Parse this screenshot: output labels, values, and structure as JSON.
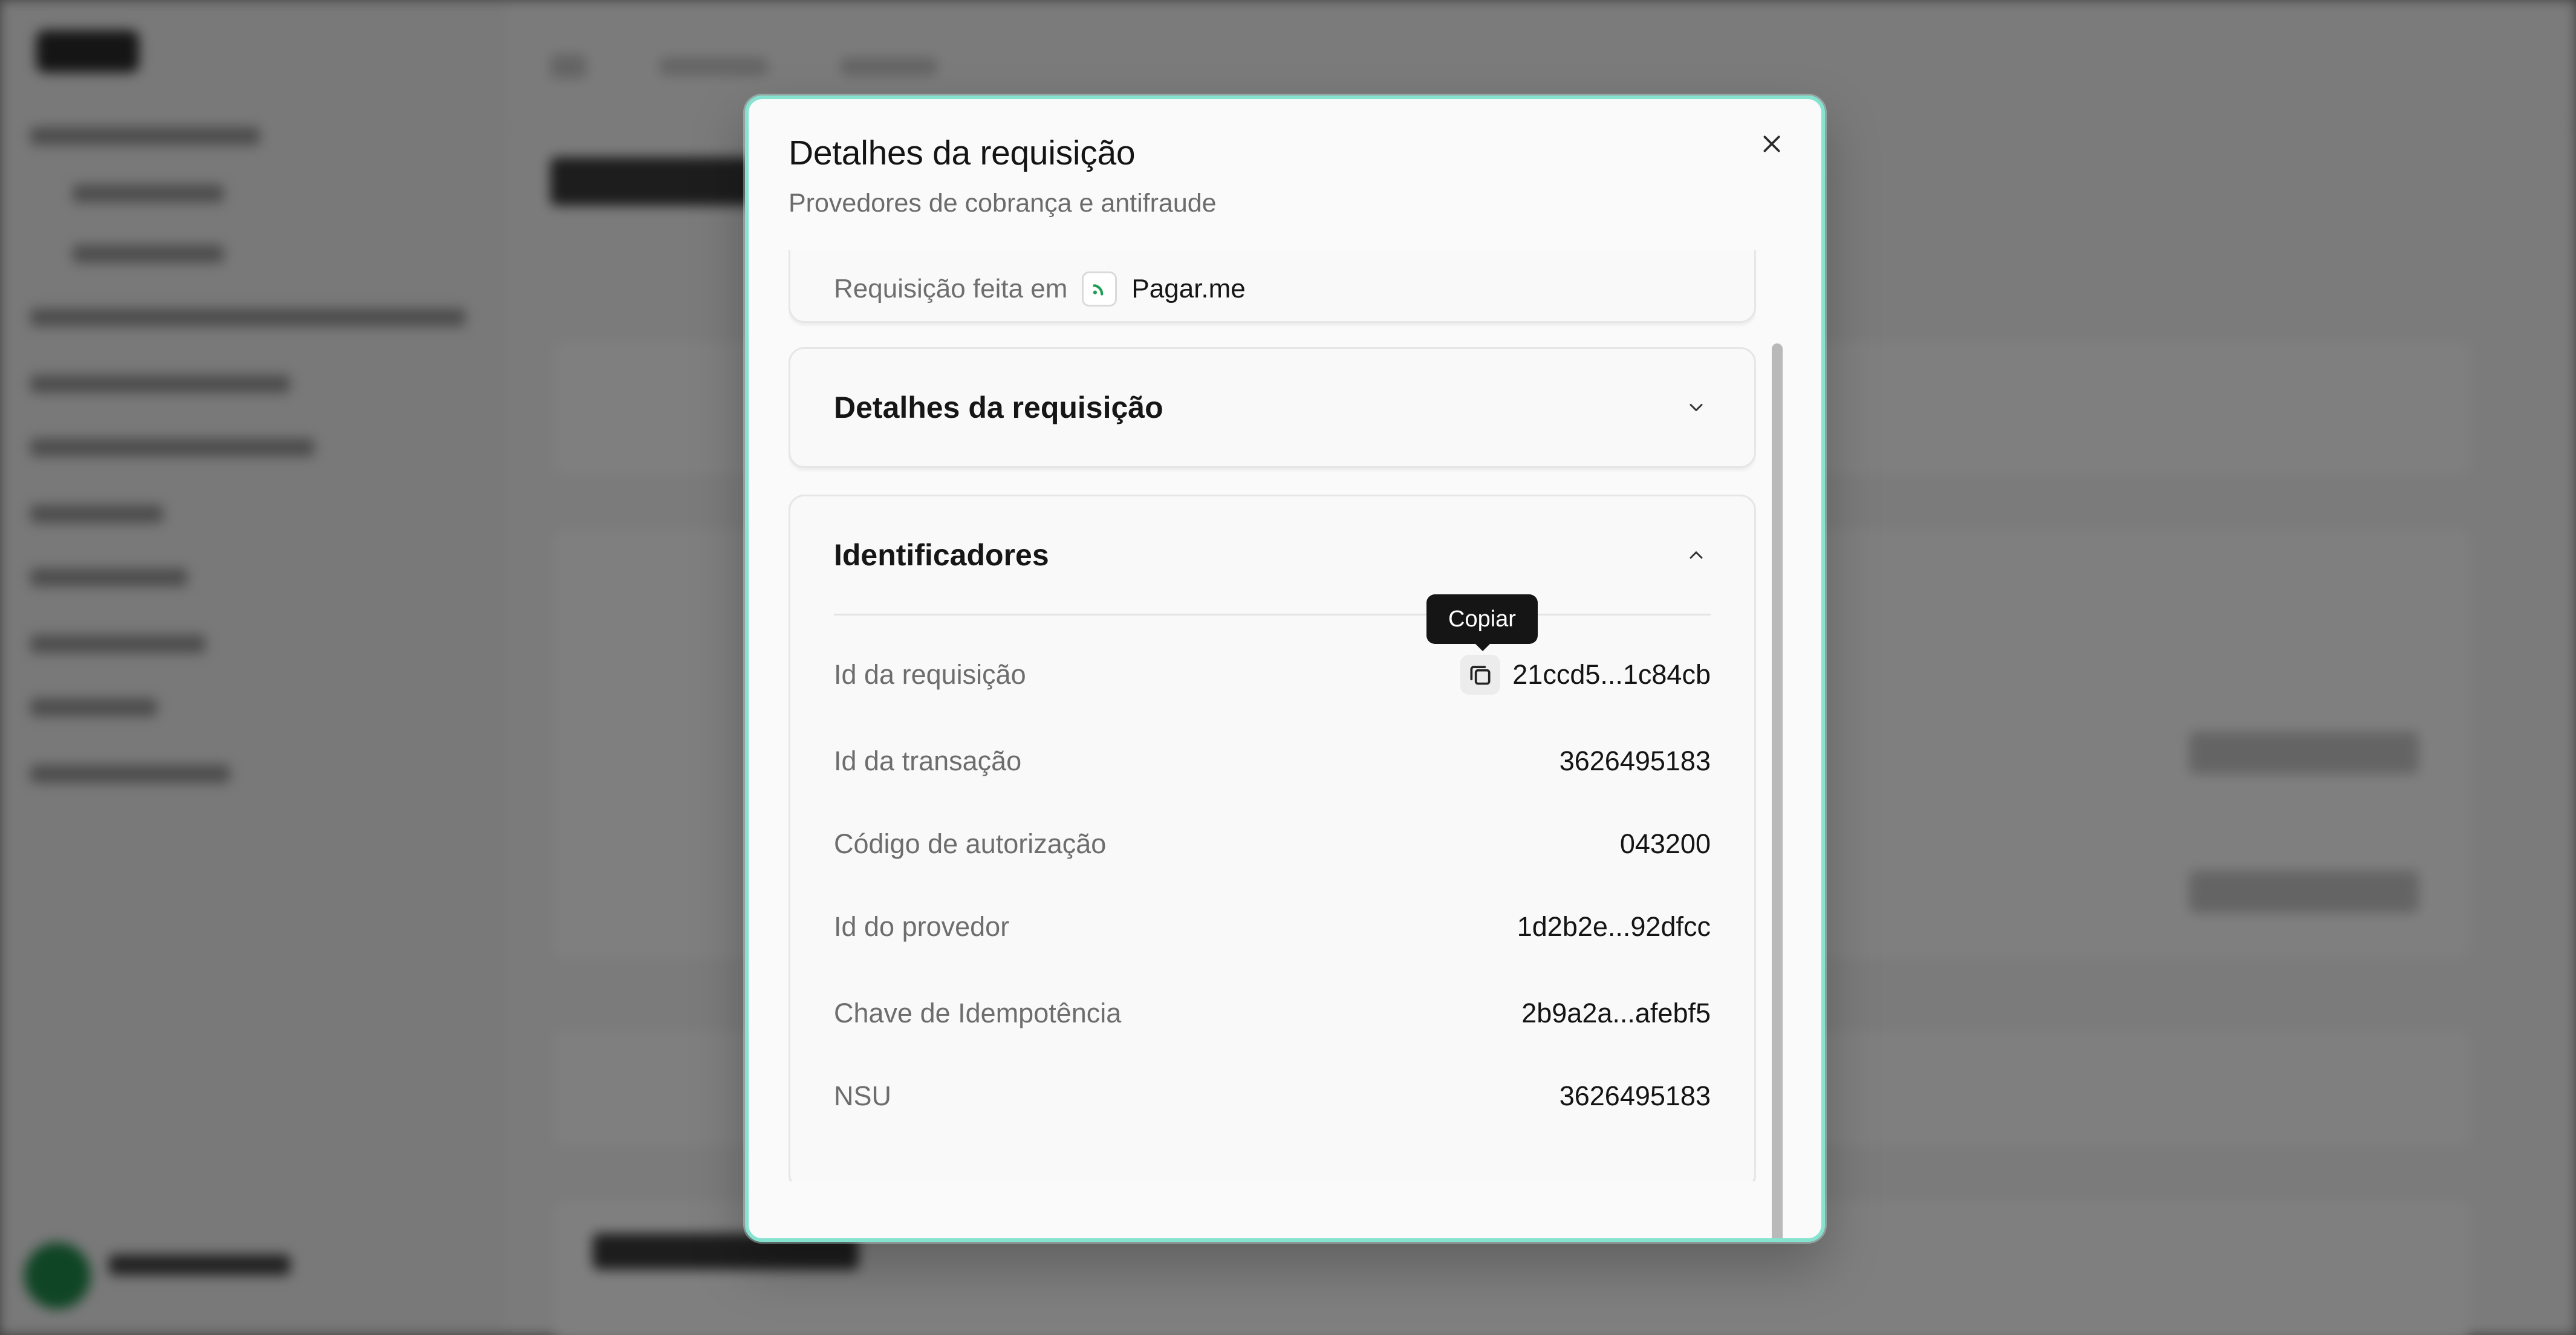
{
  "dialog": {
    "title": "Detalhes da requisição",
    "subtitle": "Provedores de cobrança e antifraude",
    "close_icon": "close-icon"
  },
  "origin": {
    "label": "Requisição feita em",
    "provider": "Pagar.me",
    "provider_icon": "pagarme-logo-icon"
  },
  "sections": {
    "request_details": {
      "title": "Detalhes da requisição",
      "expanded": false,
      "icon": "chevron-down-icon"
    },
    "identifiers": {
      "title": "Identificadores",
      "expanded": true,
      "icon": "chevron-up-icon"
    }
  },
  "identifiers": {
    "rows": [
      {
        "label": "Id da requisição",
        "value": "21ccd5...1c84cb"
      },
      {
        "label": "Id da transação",
        "value": "3626495183"
      },
      {
        "label": "Código de autorização",
        "value": "043200"
      },
      {
        "label": "Id do provedor",
        "value": "1d2b2e...92dfcc"
      },
      {
        "label": "Chave de Idempotência",
        "value": "2b9a2a...afebf5"
      },
      {
        "label": "NSU",
        "value": "3626495183"
      }
    ]
  },
  "tooltip": {
    "text": "Copiar",
    "icon": "copy-icon"
  },
  "colors": {
    "dialog_border": "#86e3cf",
    "provider_accent": "#1f9d55",
    "overlay": "#7d7d7d"
  }
}
